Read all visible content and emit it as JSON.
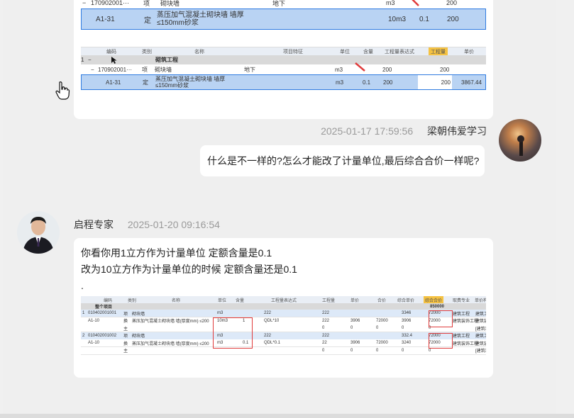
{
  "top_shot": {
    "row1": {
      "toggle": "−",
      "code": "170902001···",
      "type": "项",
      "name": "砌块墙",
      "feature": "地下",
      "unit": "m3",
      "qty": "200"
    },
    "row2": {
      "code": "A1-31",
      "type": "定",
      "name": "蒸压加气混凝土砌块墙 墙厚≤150mm砂浆",
      "unit": "10m3",
      "content": "0.1",
      "qty": "200"
    }
  },
  "shot1": {
    "headers": {
      "code": "编码",
      "category": "类别",
      "name": "名称",
      "feature": "项目特征",
      "unit": "单位",
      "content": "含量",
      "expr": "工程量表达式",
      "qty": "工程量",
      "price": "单价"
    },
    "row_group": {
      "idx": "1",
      "toggle": "−",
      "name": "砌筑工程"
    },
    "row_item": {
      "toggle": "−",
      "code": "170902001···",
      "type": "项",
      "name": "砌块墙",
      "feature": "地下",
      "unit": "m3",
      "expr": "200",
      "qty": "200"
    },
    "row_quota": {
      "code": "A1-31",
      "type": "定",
      "name": "蒸压加气混凝土砌块墙 墙厚≤150mm砂浆",
      "unit": "m3",
      "content": "0.1",
      "expr": "200",
      "qty": "200",
      "price": "3867.44"
    }
  },
  "msg1": {
    "time": "2025-01-17 17:59:56",
    "name": "梁朝伟爱学习",
    "text": "什么是不一样的?怎么才能改了计量单位,最后综合合价一样呢?"
  },
  "msg2": {
    "name": "启程专家",
    "time": "2025-01-20 09:16:54",
    "line1": "你看你用1立方作为计量单位 定额含量是0.1",
    "line2": "改为10立方作为计量单位的时候 定额含量还是0.1",
    "line3": "."
  },
  "shot2": {
    "headers": {
      "code": "编码",
      "category": "类别",
      "name": "名称",
      "unit": "单位",
      "content": "含量",
      "expr": "工程量表达式",
      "qty": "工程量",
      "price": "单价",
      "total": "合价",
      "cprice": "综合单价",
      "ctotal": "综合合价",
      "major": "取费专业",
      "unitname": "单价构成"
    },
    "grand_total": "850000",
    "group": "整个项目",
    "rows": [
      {
        "idx": "1",
        "code": "010402001001",
        "type": "项",
        "name": "砌块墙",
        "unit": "m3",
        "content": "",
        "expr": "222",
        "qty": "222",
        "price": "",
        "total": "",
        "cprice": "3346",
        "ctotal": "72000",
        "major": "建筑工程",
        "unitname": "建筑工程"
      },
      {
        "idx": "",
        "code": "A1-10",
        "type": "换",
        "name": "蒸压加气混凝土砌块墙 墙(厚度mm) ≤200",
        "unit": "10m3",
        "content": "1",
        "expr": "QDL*10",
        "qty": "222",
        "price": "3906",
        "total": "72000",
        "cprice": "3906",
        "ctotal": "72000",
        "major": "建筑装饰工程",
        "unitname": "建筑装饰"
      },
      {
        "idx": "",
        "code": "",
        "type": "主",
        "name": "",
        "unit": "",
        "content": "",
        "expr": "",
        "qty": "0",
        "price": "0",
        "total": "0",
        "cprice": "0",
        "ctotal": "0",
        "major": "",
        "unitname": "[建筑装饰]"
      },
      {
        "idx": "2",
        "code": "010402001002",
        "type": "项",
        "name": "砌块墙",
        "unit": "m3",
        "content": "",
        "expr": "222",
        "qty": "222",
        "price": "",
        "total": "",
        "cprice": "332.4",
        "ctotal": "72000",
        "major": "建筑工程",
        "unitname": "建筑工程"
      },
      {
        "idx": "",
        "code": "A1-10",
        "type": "换",
        "name": "蒸压加气混凝土砌块墙 墙(厚度mm) ≤200",
        "unit": "m3",
        "content": "0.1",
        "expr": "QDL*0.1",
        "qty": "22",
        "price": "3906",
        "total": "72000",
        "cprice": "3240",
        "ctotal": "72000",
        "major": "建筑装饰工程",
        "unitname": "建筑装饰"
      },
      {
        "idx": "",
        "code": "",
        "type": "主",
        "name": "",
        "unit": "",
        "content": "",
        "expr": "",
        "qty": "0",
        "price": "0",
        "total": "0",
        "cprice": "0",
        "ctotal": "0",
        "major": "",
        "unitname": "[建筑装饰]"
      }
    ]
  },
  "colors": {
    "accent_select": "#b9d3f3",
    "highlight_header": "#f5c242",
    "red": "#e03c3c"
  }
}
